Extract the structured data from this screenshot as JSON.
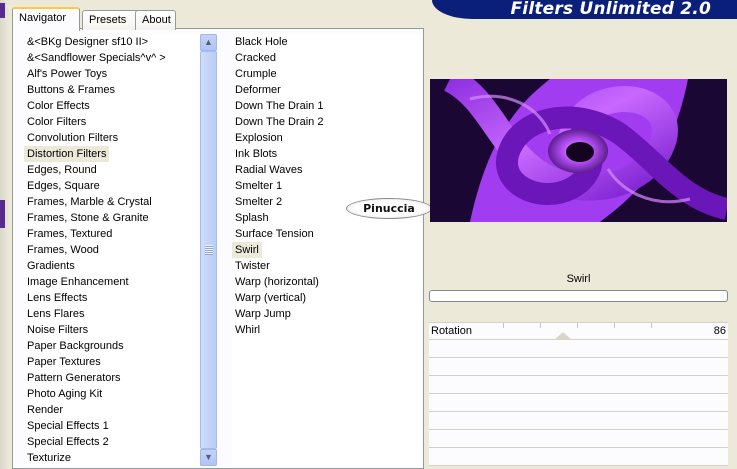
{
  "app": {
    "title": "Filters Unlimited 2.0"
  },
  "tabs": [
    {
      "label": "Navigator",
      "active": true
    },
    {
      "label": "Presets",
      "active": false
    },
    {
      "label": "About",
      "active": false
    }
  ],
  "categories": {
    "selected": "Distortion Filters",
    "items": [
      "&<BKg Designer sf10 II>",
      "&<Sandflower Specials^v^ >",
      "Alf's Power Toys",
      "Buttons & Frames",
      "Color Effects",
      "Color Filters",
      "Convolution Filters",
      "Distortion Filters",
      "Edges, Round",
      "Edges, Square",
      "Frames, Marble & Crystal",
      "Frames, Stone & Granite",
      "Frames, Textured",
      "Frames, Wood",
      "Gradients",
      "Image Enhancement",
      "Lens Effects",
      "Lens Flares",
      "Noise Filters",
      "Paper Backgrounds",
      "Paper Textures",
      "Pattern Generators",
      "Photo Aging Kit",
      "Render",
      "Special Effects 1",
      "Special Effects 2",
      "Texturize"
    ]
  },
  "filters": {
    "selected": "Swirl",
    "items": [
      "Black Hole",
      "Cracked",
      "Crumple",
      "Deformer",
      "Down The Drain 1",
      "Down The Drain 2",
      "Explosion",
      "Ink Blots",
      "Radial Waves",
      "Smelter 1",
      "Smelter 2",
      "Splash",
      "Surface Tension",
      "Swirl",
      "Twister",
      "Warp (horizontal)",
      "Warp (vertical)",
      "Warp Jump",
      "Whirl"
    ]
  },
  "watermark": {
    "text": "Pinuccia"
  },
  "panel": {
    "filter_name": "Swirl",
    "progress": 0,
    "sliders": [
      {
        "label": "Rotation",
        "value": "86",
        "level": 0.34
      }
    ],
    "empty_rows": 7
  },
  "colors": {
    "banner": "#0a1f7a",
    "swirl_purple": "#a23cf0",
    "swirl_dark": "#0a0616"
  },
  "scrollbar": {
    "up_icon": "scroll-up-arrow-icon",
    "down_icon": "scroll-down-arrow-icon"
  }
}
